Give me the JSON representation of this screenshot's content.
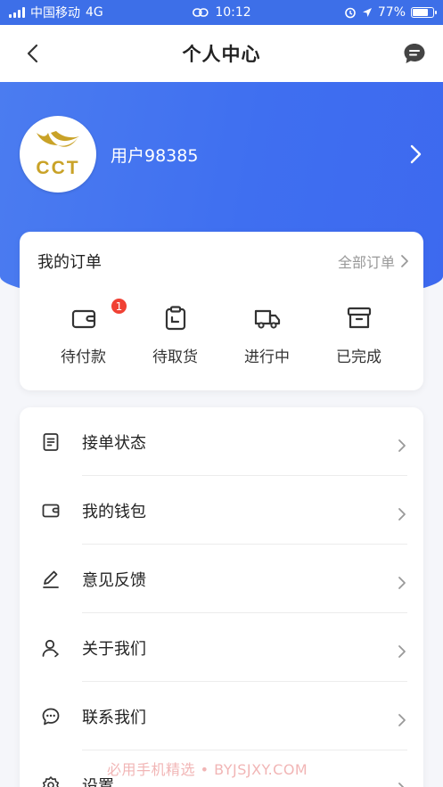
{
  "status_bar": {
    "carrier": "中国移动",
    "network": "4G",
    "time": "10:12",
    "battery_percent": "77%",
    "battery_level": 0.77
  },
  "nav": {
    "title": "个人中心",
    "back_icon": "chevron-left-icon",
    "message_icon": "chat-bubble-icon"
  },
  "profile": {
    "avatar_logo_text": "CCT",
    "username": "用户98385"
  },
  "orders": {
    "title": "我的订单",
    "view_all": "全部订单",
    "items": [
      {
        "label": "待付款",
        "icon": "wallet-icon",
        "badge": "1"
      },
      {
        "label": "待取货",
        "icon": "clipboard-icon"
      },
      {
        "label": "进行中",
        "icon": "truck-icon"
      },
      {
        "label": "已完成",
        "icon": "archive-box-icon"
      }
    ]
  },
  "menu": {
    "items": [
      {
        "label": "接单状态",
        "icon": "document-icon"
      },
      {
        "label": "我的钱包",
        "icon": "wallet-icon"
      },
      {
        "label": "意见反馈",
        "icon": "edit-pen-icon"
      },
      {
        "label": "关于我们",
        "icon": "user-icon"
      },
      {
        "label": "联系我们",
        "icon": "chat-dots-icon"
      },
      {
        "label": "设置",
        "icon": "settings-gear-icon"
      }
    ]
  },
  "watermark": "必用手机精选 • BYJSJXY.COM",
  "colors": {
    "primary": "#3f6ff0",
    "badge": "#f04134",
    "logo_gold": "#c9a227"
  }
}
